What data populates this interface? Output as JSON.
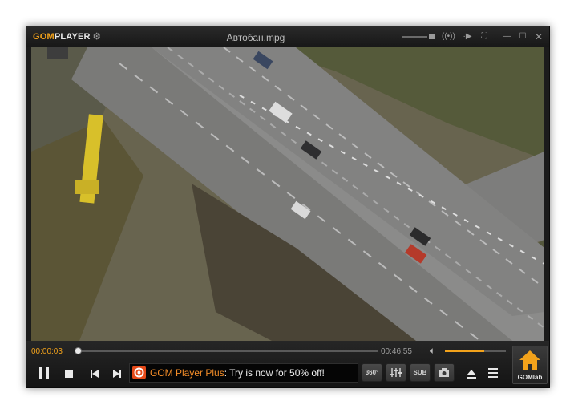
{
  "app": {
    "logo_gom": "GOM",
    "logo_player": "PLAYER",
    "title": "Автобан.mpg"
  },
  "playback": {
    "current_time": "00:00:03",
    "total_time": "00:46:55",
    "progress": 0.001,
    "volume": 0.65
  },
  "ad": {
    "brand": "GOM Player Plus",
    "message": ": Try is now for 50% off!"
  },
  "buttons": {
    "vr_label": "360°",
    "sub_label": "SUB",
    "gomlab_label": "GOMlab"
  },
  "colors": {
    "accent": "#f2a21b",
    "window_bg": "#1b1b1b",
    "ad_brand": "#f28c28"
  }
}
